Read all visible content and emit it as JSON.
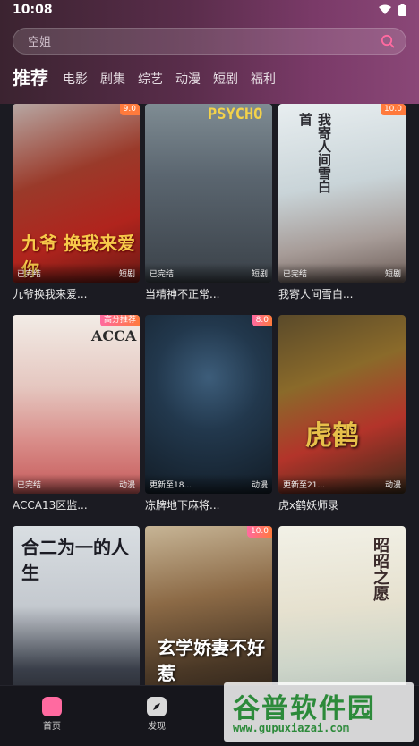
{
  "status_bar": {
    "time": "10:08"
  },
  "search": {
    "placeholder": "空姐"
  },
  "tabs": [
    {
      "label": "推荐",
      "active": true
    },
    {
      "label": "电影"
    },
    {
      "label": "剧集"
    },
    {
      "label": "综艺"
    },
    {
      "label": "动漫"
    },
    {
      "label": "短剧"
    },
    {
      "label": "福利"
    }
  ],
  "cards": [
    {
      "title": "九爷换我来爱...",
      "status": "已完结",
      "tag": "短剧",
      "badge": "9.0",
      "poster_text": "九爷 换我来爱你"
    },
    {
      "title": "当精神不正常...",
      "status": "已完结",
      "tag": "短剧",
      "badge": "",
      "poster_text": "PSYCHO"
    },
    {
      "title": "我寄人间雪白...",
      "status": "已完结",
      "tag": "短剧",
      "badge": "10.0",
      "poster_text": "我寄人间雪白首"
    },
    {
      "title": "ACCA13区监...",
      "status": "已完结",
      "tag": "动漫",
      "badge": "高分推荐",
      "poster_text": "ACCA"
    },
    {
      "title": "冻牌地下麻将...",
      "status": "更新至18...",
      "tag": "动漫",
      "badge": "8.0",
      "poster_text": ""
    },
    {
      "title": "虎x鹤妖师录",
      "status": "更新至21...",
      "tag": "动漫",
      "badge": "",
      "poster_text": "虎鹤"
    },
    {
      "title": "",
      "status": "",
      "tag": "",
      "badge": "",
      "poster_text": "合二为一的人生"
    },
    {
      "title": "",
      "status": "",
      "tag": "",
      "badge": "10.0",
      "poster_text": "玄学娇妻不好惹"
    },
    {
      "title": "",
      "status": "",
      "tag": "",
      "badge": "",
      "poster_text": "昭昭之愿"
    }
  ],
  "bottom_nav": [
    {
      "label": "首页",
      "icon": "home-icon",
      "active": true
    },
    {
      "label": "发现",
      "icon": "discover-icon"
    }
  ],
  "watermark": {
    "main": "谷普软件园",
    "url": "www.gupuxiazai.com"
  },
  "colors": {
    "accent": "#ff6aa0",
    "badge": "#ff7a3c",
    "watermark": "#2c8a3a"
  }
}
